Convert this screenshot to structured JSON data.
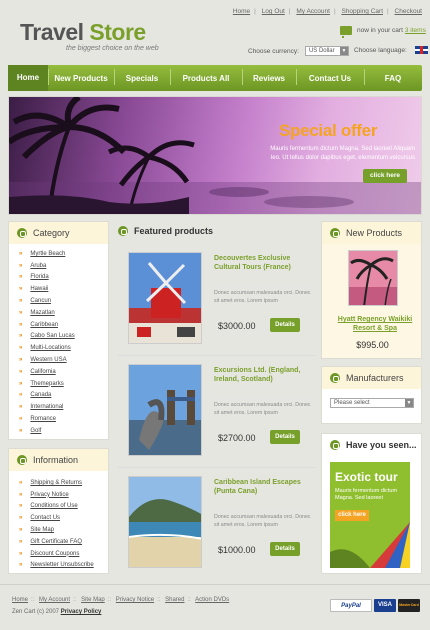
{
  "header": {
    "logo_part1": "Travel",
    "logo_part2": "Store",
    "tagline": "the biggest choice on the web",
    "top_links": [
      "Home",
      "Log Out",
      "My Account",
      "Shopping Cart",
      "Checkout"
    ],
    "cart_text": "now in your cart",
    "cart_items": "3 items",
    "currency_label": "Choose currency:",
    "currency_value": "US Dollar",
    "language_label": "Choose language:"
  },
  "nav": [
    "Home",
    "New Products",
    "Specials",
    "Products All",
    "Reviews",
    "Contact Us",
    "FAQ"
  ],
  "banner": {
    "title": "Special offer",
    "text": "Mauris fermentum dictum Magna. Sed laoreet Aliquam leo. Ut tellus dolor dapibus eget, elementum velcursus",
    "button": "click here"
  },
  "category": {
    "title": "Category",
    "items": [
      "Myrtle Beach",
      "Aruba",
      "Florida",
      "Hawaii",
      "Cancun",
      "Mazatlan",
      "Caribbean",
      "Cabo San Lucas",
      "Multi-Locations",
      "Western USA",
      "California",
      "Themeparks",
      "Canada",
      "International",
      "Romance",
      "Golf"
    ]
  },
  "information": {
    "title": "Information",
    "items": [
      "Shipping & Returns",
      "Privacy Notice",
      "Conditions of Use",
      "Contact Us",
      "Site Map",
      "Gift Certificate FAQ",
      "Discount Coupons",
      "Newsletter Unsubscribe"
    ]
  },
  "featured": {
    "title": "Featured products",
    "products": [
      {
        "title": "Decouvertes Exclusive Cultural Tours (France)",
        "desc": "Donec accumsan malesuada orci. Donec sit amet eros. Lorem ipsum",
        "price": "$3000.00",
        "button": "Details"
      },
      {
        "title": "Excursions Ltd. (England, Ireland, Scotland)",
        "desc": "Donec accumsan malesuada orci. Donec sit amet eros. Lorem ipsum",
        "price": "$2700.00",
        "button": "Details"
      },
      {
        "title": "Caribbean Island Escapes (Punta Cana)",
        "desc": "Donec accumsan malesuada orci. Donec sit amet eros. Lorem ipsum",
        "price": "$1000.00",
        "button": "Details"
      }
    ]
  },
  "new_products": {
    "title": "New Products",
    "name": "Hyatt Regency Waikiki Resort & Spa",
    "price": "$995.00"
  },
  "manufacturers": {
    "title": "Manufacturers",
    "select": "Please select"
  },
  "have_you_seen": {
    "title": "Have you seen...",
    "ad_title": "Exotic tour",
    "ad_text": "Mauris fermentum dictum Magna. Sed laoreet",
    "ad_button": "click here"
  },
  "footer": {
    "links": [
      "Home",
      "My Account",
      "Site Map",
      "Privacy Notice",
      "Shared",
      "Action DVDs"
    ],
    "copyright": "Zen Cart (c) 2007",
    "privacy": "Privacy Policy",
    "payments": [
      "PayPal",
      "VISA",
      "MasterCard"
    ]
  },
  "colors": {
    "accent": "#7aa02b",
    "orange": "#f5a323",
    "cream": "#fcf5d9"
  }
}
